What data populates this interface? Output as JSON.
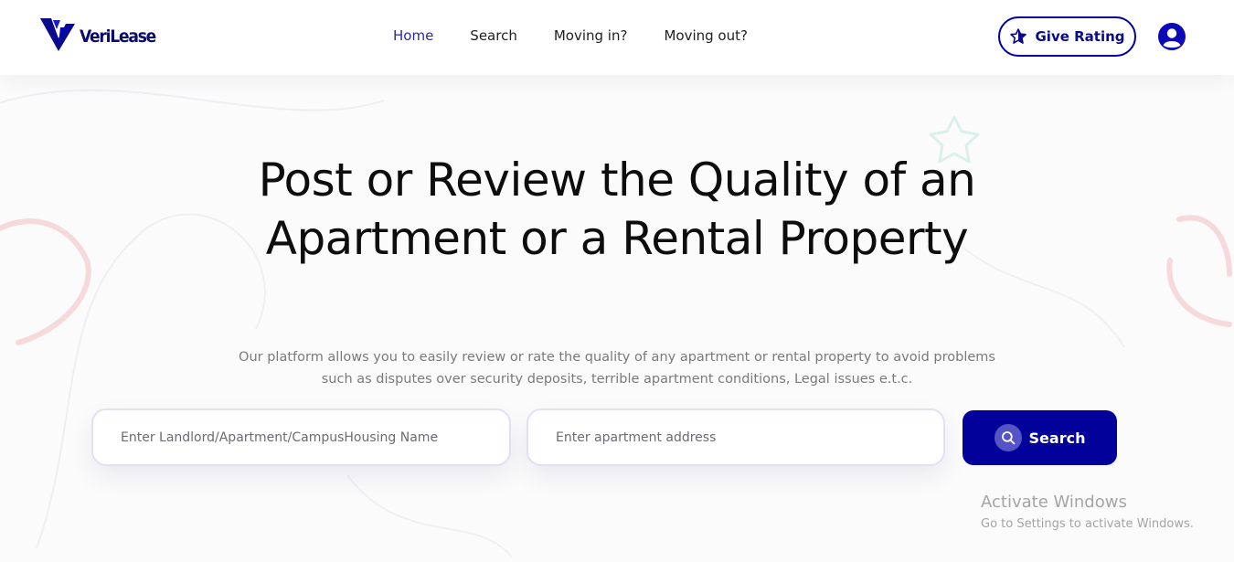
{
  "brand": {
    "name": "VeriLease",
    "color": "#0b0b6e"
  },
  "nav": {
    "items": [
      {
        "label": "Home",
        "active": true
      },
      {
        "label": "Search",
        "active": false
      },
      {
        "label": "Moving in?",
        "active": false
      },
      {
        "label": "Moving out?",
        "active": false
      }
    ]
  },
  "header": {
    "give_rating_label": "Give Rating",
    "give_rating_icon": "star-icon",
    "user_icon": "user-icon"
  },
  "hero": {
    "title": "Post or Review the Quality of an Apartment or a Rental Property",
    "subtitle": "Our platform allows you to easily review or rate the quality of any apartment or rental property to avoid problems such as disputes over security deposits, terrible apartment conditions, Legal issues e.t.c."
  },
  "search": {
    "name_placeholder": "Enter Landlord/Apartment/CampusHousing Name",
    "name_value": "",
    "address_placeholder": "Enter apartment address",
    "address_value": "",
    "button_label": "Search",
    "button_icon": "search-icon"
  },
  "watermark": {
    "line1": "Activate Windows",
    "line2": "Go to Settings to activate Windows."
  },
  "colors": {
    "accent": "#02029a",
    "nav_active": "#2d2a99",
    "text": "#0d0d0d",
    "muted": "#7a7a7a",
    "decor_pink": "#f3c9cc",
    "decor_green": "#d7efe9"
  }
}
